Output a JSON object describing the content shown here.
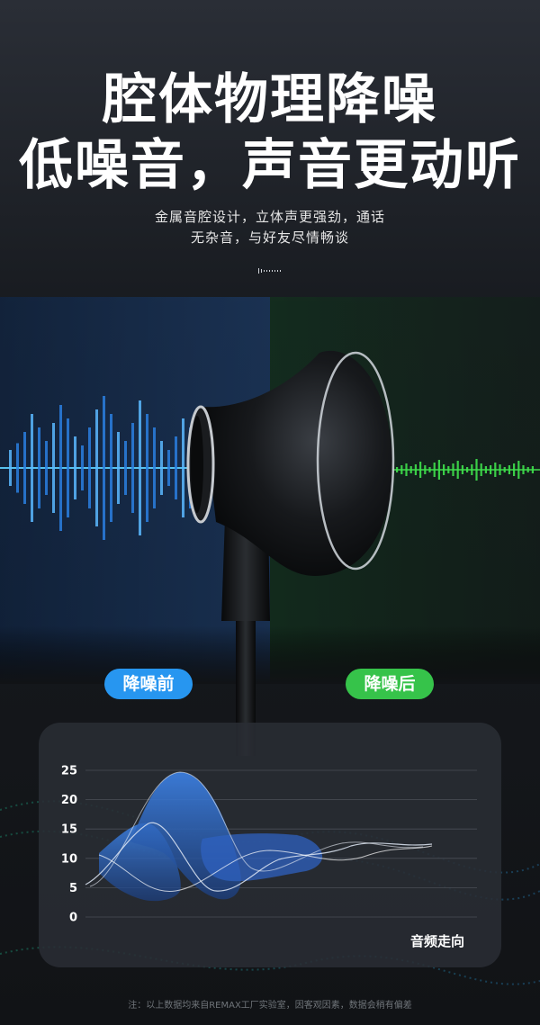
{
  "headline": {
    "line1": "腔体物理降噪",
    "line2": "低噪音，声音更动听"
  },
  "subtitle": {
    "line1": "金属音腔设计，立体声更强劲，通话",
    "line2": "无杂音，与好友尽情畅谈"
  },
  "badges": {
    "before": "降噪前",
    "after": "降噪后"
  },
  "colors": {
    "before": "#2796f0",
    "after": "#36c34a",
    "background": "#15181d"
  },
  "chart_data": {
    "type": "area",
    "xlabel": "音频走向",
    "ylabel": "",
    "ylim": [
      0,
      25
    ],
    "ticks": [
      "0",
      "5",
      "10",
      "15",
      "20",
      "25"
    ]
  },
  "footnote": "注：以上数据均来自REMAX工厂实验室，因客观因素，数据会稍有偏差"
}
